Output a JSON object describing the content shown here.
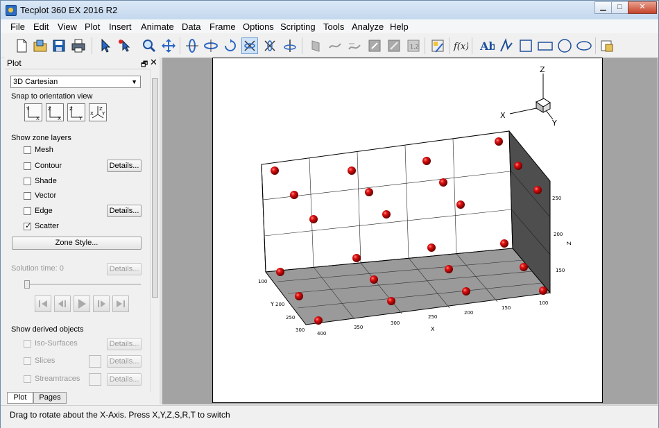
{
  "window": {
    "title": "Tecplot 360 EX 2016 R2",
    "minimize": "▁",
    "maximize": "□",
    "close": "✕"
  },
  "menu": [
    "File",
    "Edit",
    "View",
    "Plot",
    "Insert",
    "Animate",
    "Data",
    "Frame",
    "Options",
    "Scripting",
    "Tools",
    "Analyze",
    "Help"
  ],
  "toolbar_icons": [
    "new-file-icon",
    "open-folder-icon",
    "save-icon",
    "print-icon",
    "select-arrow-icon",
    "adjustor-icon",
    "zoom-icon",
    "translate-icon",
    "rotate-x-icon",
    "rotate-y-icon",
    "rotate-z-icon",
    "rotate-about-x-icon",
    "rotate-about-y-icon",
    "rotate-about-z-icon",
    "slice-icon",
    "streamtrace-icon",
    "streamtrace-rake-icon",
    "zone-create-icon",
    "zone-edit-icon",
    "contour-label-icon",
    "probe-icon",
    "equation-icon",
    "text-icon",
    "polyline-icon",
    "square-icon",
    "rectangle-icon",
    "circle-icon",
    "ellipse-icon",
    "frame-add-icon"
  ],
  "panel": {
    "title": "Plot",
    "plot_type": "3D Cartesian",
    "snap_label": "Snap to orientation view",
    "zone_layers_label": "Show zone layers",
    "layers": [
      {
        "label": "Mesh",
        "checked": false,
        "details": false
      },
      {
        "label": "Contour",
        "checked": false,
        "details": true
      },
      {
        "label": "Shade",
        "checked": false,
        "details": false
      },
      {
        "label": "Vector",
        "checked": false,
        "details": false
      },
      {
        "label": "Edge",
        "checked": false,
        "details": true
      },
      {
        "label": "Scatter",
        "checked": true,
        "details": false
      }
    ],
    "details_label": "Details...",
    "zone_style_label": "Zone Style...",
    "solution_time_label": "Solution time:  0",
    "derived_label": "Show derived objects",
    "derived": [
      {
        "label": "Iso-Surfaces"
      },
      {
        "label": "Slices"
      },
      {
        "label": "Streamtraces"
      }
    ],
    "tabs": [
      "Plot",
      "Pages"
    ]
  },
  "orient_views": [
    {
      "top": "Y",
      "bottom": "X"
    },
    {
      "top": "Z",
      "bottom": "X"
    },
    {
      "top": "Z",
      "bottom": "Y"
    },
    {
      "top": "Z",
      "left": "X",
      "right": "Y"
    }
  ],
  "axes": {
    "triad": {
      "z": "Z",
      "x": "X",
      "y": "Y"
    },
    "x_label": "X",
    "y_label": "Y",
    "z_label": "Z",
    "x_ticks": [
      "400",
      "350",
      "300",
      "250",
      "200",
      "150",
      "100"
    ],
    "y_ticks": [
      "100",
      "200",
      "250",
      "300"
    ],
    "z_ticks": [
      "250",
      "200",
      "150"
    ]
  },
  "status": "Drag to rotate about the X-Axis. Press X,Y,Z,S,R,T to switch",
  "colors": {
    "scatter": "#d40000",
    "floor": "#9a9a9a",
    "side": "#555555",
    "workspace": "#a3a3a3"
  }
}
